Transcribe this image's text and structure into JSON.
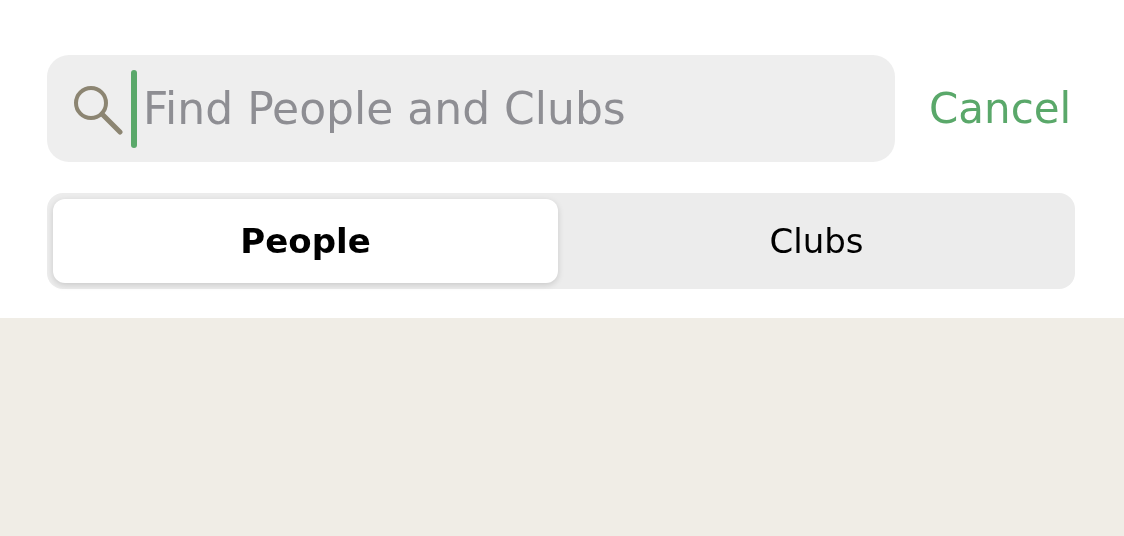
{
  "search": {
    "placeholder": "Find People and Clubs",
    "focused": true
  },
  "cancel": {
    "label": "Cancel"
  },
  "segments": [
    {
      "label": "People",
      "selected": true
    },
    {
      "label": "Clubs",
      "selected": false
    }
  ]
}
